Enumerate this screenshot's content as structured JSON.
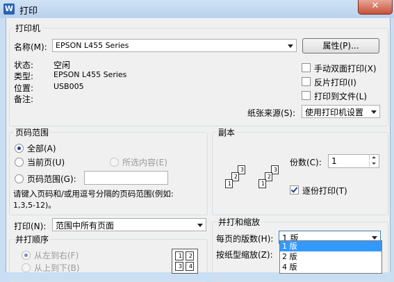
{
  "window": {
    "title": "打印",
    "app_icon": "W",
    "close_glyph": "✕"
  },
  "printer": {
    "group_label": "打印机",
    "name_label": "名称(M):",
    "name_value": "EPSON L455 Series",
    "properties_button": "属性(P)...",
    "status_label": "状态:",
    "status_value": "空闲",
    "type_label": "类型:",
    "type_value": "EPSON L455 Series",
    "location_label": "位置:",
    "location_value": "USB005",
    "comment_label": "备注:",
    "manual_duplex": "手动双面打印(X)",
    "reverse_print": "反片打印(I)",
    "print_to_file": "打印到文件(L)",
    "paper_source_label": "纸张来源(S):",
    "paper_source_value": "使用打印机设置"
  },
  "page_range": {
    "group_label": "页码范围",
    "all": "全部(A)",
    "current": "当前页(U)",
    "selection": "所选内容(E)",
    "pages": "页码范围(G):",
    "hint_line1": "请键入页码和/或用逗号分隔的页码范围(例如:",
    "hint_line2": "1,3,5-12)。"
  },
  "copies": {
    "group_label": "副本",
    "count_label": "份数(C):",
    "count_value": "1",
    "collate": "逐份打印(T)"
  },
  "print_what": {
    "label": "打印(N):",
    "value": "范围中所有页面"
  },
  "order": {
    "group_label": "并打顺序",
    "left_to_right": "从左到右(F)",
    "top_to_bottom": "从上到下(B)"
  },
  "zoom": {
    "group_label": "并打和缩放",
    "pages_per_sheet_label": "每页的版数(H):",
    "pages_per_sheet_value": "1 版",
    "scale_label": "按纸型缩放(Z):",
    "options": [
      "1 版",
      "2 版",
      "4 版"
    ]
  }
}
